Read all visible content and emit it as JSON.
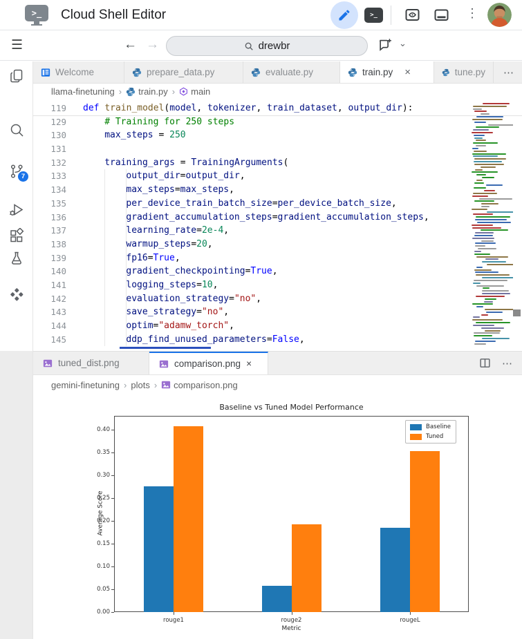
{
  "icons": {
    "hamburger": "☰",
    "back": "←",
    "forward": "→",
    "kebab": "⋮",
    "more": "⋯",
    "close": "×",
    "chevron_down": "⌄",
    "crumb_sep": "›",
    "terminal_prompt": ">_"
  },
  "header": {
    "title": "Cloud Shell Editor"
  },
  "toolbar": {
    "search": {
      "value": "drewbr"
    }
  },
  "activity_bar": {
    "source_control_badge": "7"
  },
  "editor": {
    "tabs": [
      {
        "label": "Welcome",
        "icon": "welcome",
        "active": false,
        "closable": false
      },
      {
        "label": "prepare_data.py",
        "icon": "python",
        "active": false,
        "closable": false
      },
      {
        "label": "evaluate.py",
        "icon": "python",
        "active": false,
        "closable": false
      },
      {
        "label": "train.py",
        "icon": "python",
        "active": true,
        "closable": true
      },
      {
        "label": "tune.py",
        "icon": "python",
        "active": false,
        "closable": false
      }
    ],
    "breadcrumb": [
      {
        "label": "llama-finetuning"
      },
      {
        "label": "train.py",
        "icon": "python"
      },
      {
        "label": "main",
        "icon": "symbol"
      }
    ],
    "code_lines": [
      {
        "num": "119",
        "indent": 0,
        "fold_after": true,
        "tokens": [
          [
            "kw",
            "def"
          ],
          [
            "pl",
            " "
          ],
          [
            "fn",
            "train_model"
          ],
          [
            "pl",
            "("
          ],
          [
            "var",
            "model"
          ],
          [
            "pl",
            ", "
          ],
          [
            "var",
            "tokenizer"
          ],
          [
            "pl",
            ", "
          ],
          [
            "var",
            "train_dataset"
          ],
          [
            "pl",
            ", "
          ],
          [
            "var",
            "output_dir"
          ],
          [
            "pl",
            "):"
          ]
        ]
      },
      {
        "num": "129",
        "indent": 4,
        "tokens": [
          [
            "com",
            "# Training for 250 steps"
          ]
        ]
      },
      {
        "num": "130",
        "indent": 4,
        "tokens": [
          [
            "var",
            "max_steps"
          ],
          [
            "pl",
            " = "
          ],
          [
            "num",
            "250"
          ]
        ]
      },
      {
        "num": "131",
        "indent": 0,
        "tokens": []
      },
      {
        "num": "132",
        "indent": 4,
        "tokens": [
          [
            "var",
            "training_args"
          ],
          [
            "pl",
            " = "
          ],
          [
            "var",
            "TrainingArguments"
          ],
          [
            "pl",
            "("
          ]
        ]
      },
      {
        "num": "133",
        "indent": 8,
        "tokens": [
          [
            "var",
            "output_dir"
          ],
          [
            "pl",
            "="
          ],
          [
            "var",
            "output_dir"
          ],
          [
            "pl",
            ","
          ]
        ]
      },
      {
        "num": "134",
        "indent": 8,
        "tokens": [
          [
            "var",
            "max_steps"
          ],
          [
            "pl",
            "="
          ],
          [
            "var",
            "max_steps"
          ],
          [
            "pl",
            ","
          ]
        ]
      },
      {
        "num": "135",
        "indent": 8,
        "tokens": [
          [
            "var",
            "per_device_train_batch_size"
          ],
          [
            "pl",
            "="
          ],
          [
            "var",
            "per_device_batch_size"
          ],
          [
            "pl",
            ","
          ]
        ]
      },
      {
        "num": "136",
        "indent": 8,
        "tokens": [
          [
            "var",
            "gradient_accumulation_steps"
          ],
          [
            "pl",
            "="
          ],
          [
            "var",
            "gradient_accumulation_steps"
          ],
          [
            "pl",
            ","
          ]
        ]
      },
      {
        "num": "137",
        "indent": 8,
        "tokens": [
          [
            "var",
            "learning_rate"
          ],
          [
            "pl",
            "="
          ],
          [
            "num",
            "2e-4"
          ],
          [
            "pl",
            ","
          ]
        ]
      },
      {
        "num": "138",
        "indent": 8,
        "tokens": [
          [
            "var",
            "warmup_steps"
          ],
          [
            "pl",
            "="
          ],
          [
            "num",
            "20"
          ],
          [
            "pl",
            ","
          ]
        ]
      },
      {
        "num": "139",
        "indent": 8,
        "tokens": [
          [
            "var",
            "fp16"
          ],
          [
            "pl",
            "="
          ],
          [
            "kw",
            "True"
          ],
          [
            "pl",
            ","
          ]
        ]
      },
      {
        "num": "140",
        "indent": 8,
        "tokens": [
          [
            "var",
            "gradient_checkpointing"
          ],
          [
            "pl",
            "="
          ],
          [
            "kw",
            "True"
          ],
          [
            "pl",
            ","
          ]
        ]
      },
      {
        "num": "141",
        "indent": 8,
        "tokens": [
          [
            "var",
            "logging_steps"
          ],
          [
            "pl",
            "="
          ],
          [
            "num",
            "10"
          ],
          [
            "pl",
            ","
          ]
        ]
      },
      {
        "num": "142",
        "indent": 8,
        "tokens": [
          [
            "var",
            "evaluation_strategy"
          ],
          [
            "pl",
            "="
          ],
          [
            "str",
            "\"no\""
          ],
          [
            "pl",
            ","
          ]
        ]
      },
      {
        "num": "143",
        "indent": 8,
        "tokens": [
          [
            "var",
            "save_strategy"
          ],
          [
            "pl",
            "="
          ],
          [
            "str",
            "\"no\""
          ],
          [
            "pl",
            ","
          ]
        ]
      },
      {
        "num": "144",
        "indent": 8,
        "tokens": [
          [
            "var",
            "optim"
          ],
          [
            "pl",
            "="
          ],
          [
            "str",
            "\"adamw_torch\""
          ],
          [
            "pl",
            ","
          ]
        ]
      },
      {
        "num": "145",
        "indent": 8,
        "tokens": [
          [
            "var",
            "ddp_find_unused_parameters"
          ],
          [
            "pl",
            "="
          ],
          [
            "kw",
            "False"
          ],
          [
            "pl",
            ","
          ]
        ]
      }
    ]
  },
  "panel": {
    "tabs": [
      {
        "label": "tuned_dist.png",
        "icon": "image",
        "active": false,
        "closable": false
      },
      {
        "label": "comparison.png",
        "icon": "image",
        "active": true,
        "closable": true
      }
    ],
    "breadcrumb": [
      {
        "label": "gemini-finetuning"
      },
      {
        "label": "plots"
      },
      {
        "label": "comparison.png",
        "icon": "image"
      }
    ]
  },
  "chart_data": {
    "type": "bar",
    "title": "Baseline vs Tuned Model Performance",
    "categories": [
      "rouge1",
      "rouge2",
      "rougeL"
    ],
    "series": [
      {
        "name": "Baseline",
        "color": "#1f77b4",
        "values": [
          0.275,
          0.058,
          0.184
        ]
      },
      {
        "name": "Tuned",
        "color": "#ff7f0e",
        "values": [
          0.407,
          0.192,
          0.353
        ]
      }
    ],
    "xlabel": "Metric",
    "ylabel": "Average Score",
    "ylim": [
      0,
      0.43
    ],
    "ytick_step": 0.05,
    "ytick_max": 0.4,
    "legend_position": "upper right",
    "grid": false
  }
}
